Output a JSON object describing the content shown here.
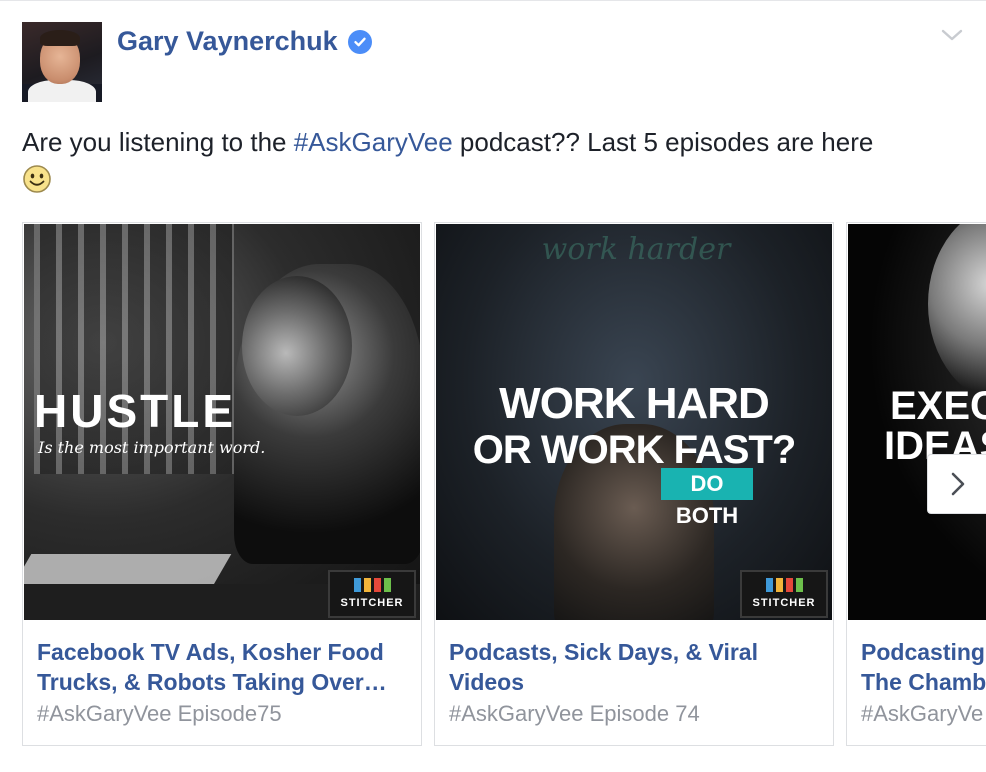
{
  "post": {
    "author": "Gary Vaynerchuk",
    "text_before": "Are you listening to the ",
    "hashtag": "#AskGaryVee",
    "text_after": " podcast?? Last 5 episodes are here"
  },
  "cards": [
    {
      "title_line1": "Facebook TV Ads, Kosher Food",
      "title_line2": "Trucks, & Robots Taking Over…",
      "subtitle": "#AskGaryVee Episode75",
      "image_title": "HUSTLE",
      "image_subtitle": "Is the most important word.",
      "badge": "STITCHER"
    },
    {
      "title_line1": "Podcasts, Sick Days, & Viral",
      "title_line2": "Videos",
      "subtitle": "#AskGaryVee Episode 74",
      "image_line1": "WORK HARD",
      "image_line2": "OR WORK FAST?",
      "image_tag": "DO BOTH",
      "badge": "STITCHER"
    },
    {
      "title_line1": "Podcasting",
      "title_line2": "The Chamb",
      "subtitle": "#AskGaryVe",
      "image_line1": "EXEC",
      "image_line2": "IDEAS"
    }
  ],
  "colors": {
    "link": "#365899",
    "text": "#1d2129",
    "muted": "#90949c",
    "verified": "#4b8df8",
    "teal_tag": "#19b3b1"
  },
  "icons": {
    "verified": "verified-badge-icon",
    "menu": "chevron-down-icon",
    "emoji": "smiley-emoji-icon",
    "next": "chevron-right-icon"
  }
}
